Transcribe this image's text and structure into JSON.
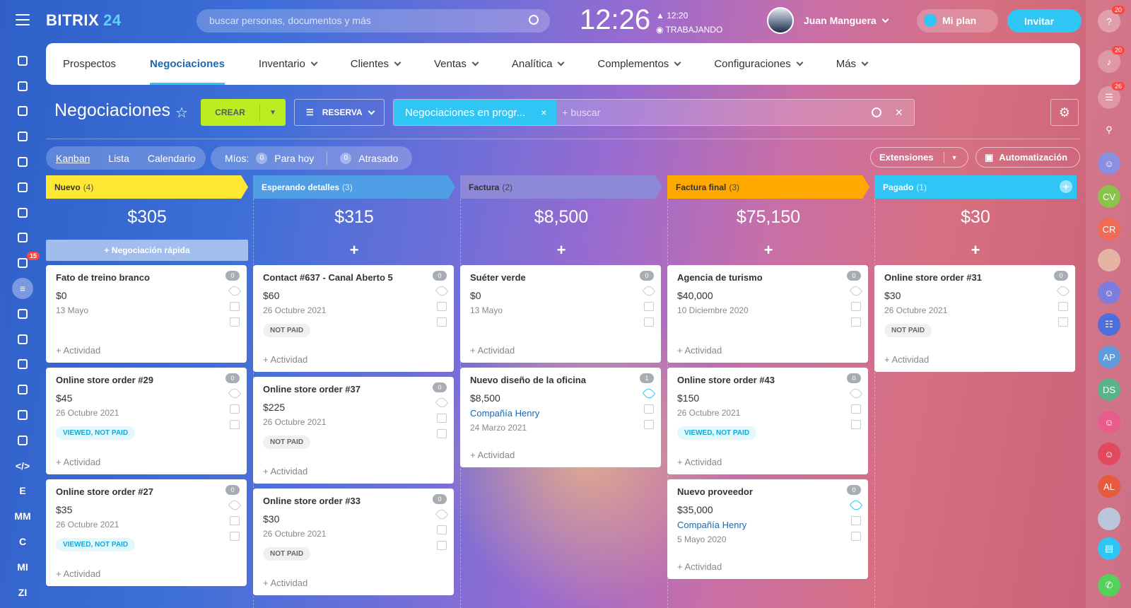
{
  "app": {
    "logo_main": "BITRIX",
    "logo_num": "24"
  },
  "search": {
    "placeholder": "buscar personas, documentos y más"
  },
  "clock": {
    "time": "12:26",
    "work_time": "12:20",
    "status": "TRABAJANDO"
  },
  "user": {
    "name": "Juan Manguera"
  },
  "plan": {
    "label": "Mi plan"
  },
  "invite": {
    "label": "Invitar"
  },
  "left_sidebar": {
    "badge": "15",
    "text_items": [
      "E",
      "MM",
      "C",
      "MI",
      "ZI"
    ]
  },
  "right_sidebar": {
    "notif_count": "20",
    "chat_count": "26",
    "help_count": "20",
    "avatars": [
      "CV",
      "CR",
      "AP",
      "DS",
      "AL"
    ]
  },
  "nav": {
    "tabs": [
      "Prospectos",
      "Negociaciones",
      "Inventario",
      "Clientes",
      "Ventas",
      "Analítica",
      "Complementos",
      "Configuraciones",
      "Más"
    ]
  },
  "toolbar": {
    "title": "Negociaciones",
    "create": "CREAR",
    "reserva": "RESERVA",
    "filter_chip": "Negociaciones en progr...",
    "filter_placeholder": "+ buscar"
  },
  "views": {
    "kanban": "Kanban",
    "lista": "Lista",
    "calendario": "Calendario"
  },
  "mios": {
    "label": "Míos:",
    "para_hoy_count": "0",
    "para_hoy": "Para hoy",
    "atrasado_count": "0",
    "atrasado": "Atrasado"
  },
  "extensions": {
    "label": "Extensiones"
  },
  "automation": {
    "label": "Automatización"
  },
  "colors": {
    "nuevo": "#ffe833",
    "esperando": "#4f9ee6",
    "factura": "#8d89d8",
    "factura_final": "#ffa900",
    "pagado": "#2fc6f6"
  },
  "columns": [
    {
      "name": "Nuevo",
      "count": "(4)",
      "amount": "$305",
      "quick": "Negociación rápida"
    },
    {
      "name": "Esperando detalles",
      "count": "(3)",
      "amount": "$315"
    },
    {
      "name": "Factura",
      "count": "(2)",
      "amount": "$8,500"
    },
    {
      "name": "Factura final",
      "count": "(3)",
      "amount": "$75,150"
    },
    {
      "name": "Pagado",
      "count": "(1)",
      "amount": "$30"
    }
  ],
  "cards": {
    "c0": [
      {
        "title": "Fato de treino branco",
        "price": "$0",
        "date": "13 Mayo",
        "badge": "0",
        "activity": "+ Actividad"
      },
      {
        "title": "Online store order #29",
        "price": "$45",
        "date": "26 Octubre 2021",
        "status": "VIEWED, NOT PAID",
        "badge": "0",
        "activity": "+ Actividad"
      },
      {
        "title": "Online store order #27",
        "price": "$35",
        "date": "26 Octubre 2021",
        "status": "VIEWED, NOT PAID",
        "badge": "0",
        "activity": "+ Actividad"
      }
    ],
    "c1": [
      {
        "title": "Contact #637 - Canal Aberto 5",
        "price": "$60",
        "date": "26 Octubre 2021",
        "status": "NOT PAID",
        "badge": "0",
        "activity": "+ Actividad"
      },
      {
        "title": "Online store order #37",
        "price": "$225",
        "date": "26 Octubre 2021",
        "status": "NOT PAID",
        "badge": "0",
        "activity": "+ Actividad"
      },
      {
        "title": "Online store order #33",
        "price": "$30",
        "date": "26 Octubre 2021",
        "status": "NOT PAID",
        "badge": "0",
        "activity": "+ Actividad"
      }
    ],
    "c2": [
      {
        "title": "Suéter verde",
        "price": "$0",
        "date": "13 Mayo",
        "badge": "0",
        "activity": "+ Actividad"
      },
      {
        "title": "Nuevo diseño de la oficina",
        "price": "$8,500",
        "company": "Compañía Henry",
        "date": "24 Marzo 2021",
        "badge": "1",
        "activity": "+ Actividad"
      }
    ],
    "c3": [
      {
        "title": "Agencia de turismo",
        "price": "$40,000",
        "date": "10 Diciembre 2020",
        "badge": "0",
        "activity": "+ Actividad"
      },
      {
        "title": "Online store order #43",
        "price": "$150",
        "date": "26 Octubre 2021",
        "status": "VIEWED, NOT PAID",
        "badge": "0",
        "activity": "+ Actividad"
      },
      {
        "title": "Nuevo proveedor",
        "price": "$35,000",
        "company": "Compañía Henry",
        "date": "5 Mayo 2020",
        "badge": "0",
        "activity": "+ Actividad"
      }
    ],
    "c4": [
      {
        "title": "Online store order #31",
        "price": "$30",
        "date": "26 Octubre 2021",
        "status": "NOT PAID",
        "badge": "0",
        "activity": "+ Actividad"
      }
    ]
  }
}
